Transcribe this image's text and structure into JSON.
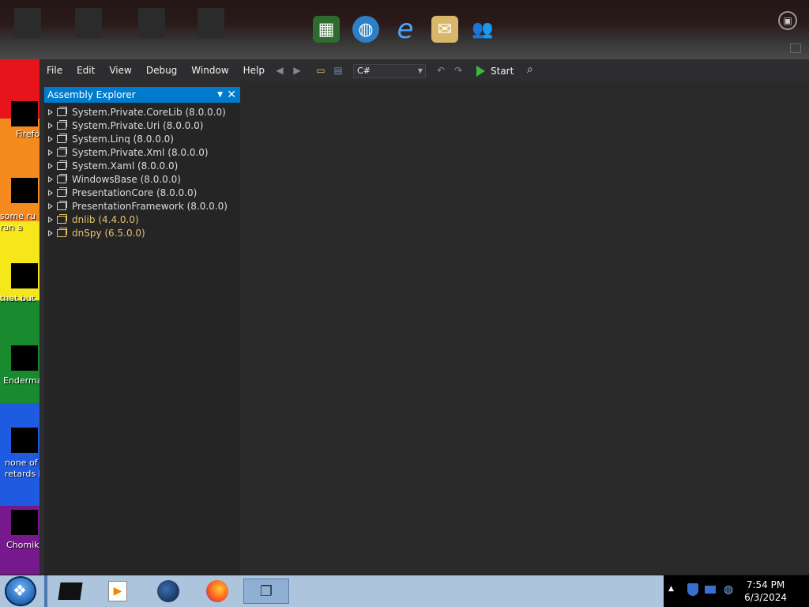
{
  "menu": [
    "File",
    "Edit",
    "View",
    "Debug",
    "Window",
    "Help"
  ],
  "toolbar": {
    "language": "C#",
    "start_label": "Start"
  },
  "explorer": {
    "title": "Assembly Explorer",
    "items": [
      {
        "label": "System.Private.CoreLib (8.0.0.0)"
      },
      {
        "label": "System.Private.Uri (8.0.0.0)"
      },
      {
        "label": "System.Linq (8.0.0.0)"
      },
      {
        "label": "System.Private.Xml (8.0.0.0)"
      },
      {
        "label": "System.Xaml (8.0.0.0)"
      },
      {
        "label": "WindowsBase (8.0.0.0)"
      },
      {
        "label": "PresentationCore (8.0.0.0)"
      },
      {
        "label": "PresentationFramework (8.0.0.0)"
      },
      {
        "label": "dnlib (4.4.0.0)"
      },
      {
        "label": "dnSpy (6.5.0.0)"
      }
    ]
  },
  "desktop_icons": [
    {
      "label": "Firefo"
    },
    {
      "label": "some ru\nran a"
    },
    {
      "label": "that but"
    },
    {
      "label": "Enderma"
    },
    {
      "label": "none of\nretards k"
    },
    {
      "label": "Chomik"
    }
  ],
  "clock": {
    "time": "7:54 PM",
    "date": "6/3/2024"
  },
  "colors": {
    "accent": "#007acc",
    "background": "#2d2d30",
    "taskbar": "#acc5dd"
  }
}
